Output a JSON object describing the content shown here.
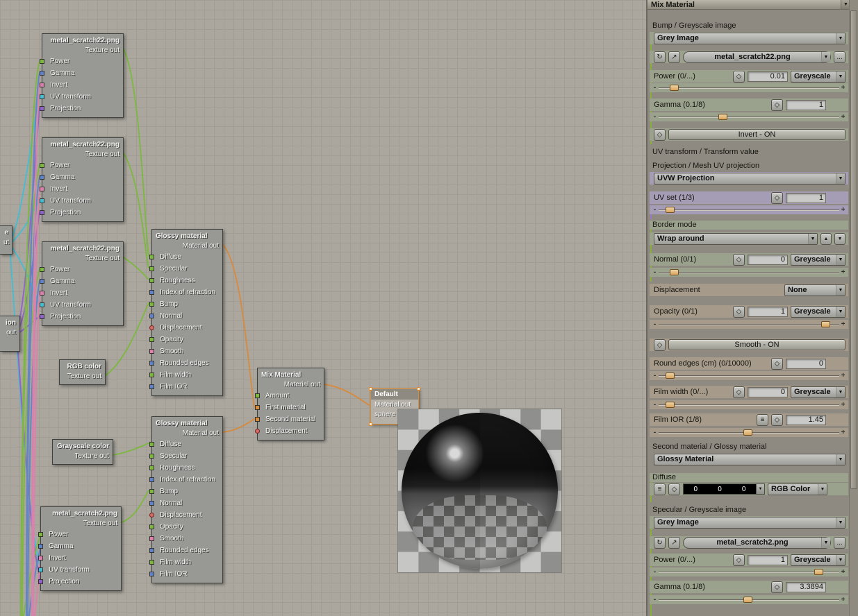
{
  "colors": {
    "canvas_bg": "#aba79f",
    "panel_bg": "#8e8a81",
    "selection_orange": "#e08a2e",
    "pin": {
      "green": "#7cb83e",
      "blue": "#5f82c8",
      "pink": "#df7fae",
      "cyan": "#45bdd3",
      "purple": "#8f62c9",
      "orange": "#d78a3c",
      "red": "#cf7068"
    }
  },
  "canvas": {
    "texture_pins": [
      {
        "label": "Power",
        "color": "green"
      },
      {
        "label": "Gamma",
        "color": "blue"
      },
      {
        "label": "Invert",
        "color": "pink"
      },
      {
        "label": "UV transform",
        "color": "cyan"
      },
      {
        "label": "Projection",
        "color": "purple"
      }
    ],
    "glossy_pins": [
      {
        "label": "Diffuse",
        "color": "green"
      },
      {
        "label": "Specular",
        "color": "green"
      },
      {
        "label": "Roughness",
        "color": "green"
      },
      {
        "label": "Index of refraction",
        "color": "blue"
      },
      {
        "label": "Bump",
        "color": "green"
      },
      {
        "label": "Normal",
        "color": "blue"
      },
      {
        "label": "Displacement",
        "color": "red"
      },
      {
        "label": "Opacity",
        "color": "green"
      },
      {
        "label": "Smooth",
        "color": "pink"
      },
      {
        "label": "Rounded edges",
        "color": "blue"
      },
      {
        "label": "Film width",
        "color": "green"
      },
      {
        "label": "Film IOR",
        "color": "blue"
      }
    ],
    "mix_pins": [
      {
        "label": "Amount",
        "color": "green"
      },
      {
        "label": "First material",
        "color": "orange"
      },
      {
        "label": "Second material",
        "color": "orange"
      },
      {
        "label": "Displacement",
        "color": "red"
      }
    ],
    "nodes": {
      "tex1": {
        "title": "metal_scratch22.png",
        "out_label": "Texture out"
      },
      "tex2": {
        "title": "metal_scratch22.png",
        "out_label": "Texture out"
      },
      "tex3": {
        "title": "metal_scratch22.png",
        "out_label": "Texture out"
      },
      "tex4": {
        "title": "metal_scratch2.png",
        "out_label": "Texture out"
      },
      "glossy1": {
        "title": "Glossy material",
        "out_label": "Material out"
      },
      "glossy2": {
        "title": "Glossy material",
        "out_label": "Material out"
      },
      "rgb": {
        "title": "RGB color",
        "out_label": "Texture out"
      },
      "grayscale": {
        "title": "Grayscale color",
        "out_label": "Texture out"
      },
      "mix": {
        "title": "Mix Material",
        "out_label": "Material out"
      },
      "target": {
        "title": "Default",
        "out_label": "Material out",
        "subtitle": "sphere"
      },
      "partial_top": {
        "title": "e",
        "out_label": "ut"
      },
      "partial_bottom": {
        "title": "ion",
        "out_label": "out"
      }
    }
  },
  "panel": {
    "header": {
      "title": "Mix Material"
    },
    "icons": {
      "refresh": "↻",
      "open": "↗",
      "diamond": "◇",
      "list": "≡",
      "dropdown": "▼",
      "up": "▲",
      "down": "▼",
      "more": "..."
    },
    "slider": {
      "minus": "-",
      "plus": "+"
    },
    "bump": {
      "section_label": "Bump / Greyscale image",
      "type_dropdown": "Grey Image",
      "file_dropdown": "metal_scratch22.png",
      "power_label": "Power (0/...)",
      "power_value": "0.01",
      "power_channel": "Greyscale",
      "gamma_label": "Gamma (0.1/8)",
      "gamma_value": "1",
      "invert_button": "Invert - ON",
      "uv_transform_label": "UV transform / Transform value",
      "projection_label": "Projection / Mesh UV projection",
      "projection_dropdown": "UVW Projection",
      "uv_set_label": "UV set (1/3)",
      "uv_set_value": "1",
      "border_mode_label": "Border mode",
      "border_mode_dropdown": "Wrap around",
      "normal_label": "Normal (0/1)",
      "normal_value": "0",
      "normal_channel": "Greyscale"
    },
    "mix": {
      "displacement_label": "Displacement",
      "displacement_dropdown": "None",
      "opacity_label": "Opacity (0/1)",
      "opacity_value": "1",
      "opacity_channel": "Greyscale",
      "smooth_button": "Smooth - ON",
      "round_edges_label": "Round edges (cm) (0/10000)",
      "round_edges_value": "0",
      "film_width_label": "Film width (0/...)",
      "film_width_value": "0",
      "film_width_channel": "Greyscale",
      "film_ior_label": "Film IOR (1/8)",
      "film_ior_value": "1.45"
    },
    "second": {
      "section_label": "Second material / Glossy material",
      "material_dropdown": "Glossy Material",
      "diffuse_label": "Diffuse",
      "diffuse_r": "0",
      "diffuse_g": "0",
      "diffuse_b": "0",
      "diffuse_channel": "RGB Color",
      "specular_label": "Specular / Greyscale image",
      "type_dropdown": "Grey Image",
      "file_dropdown": "metal_scratch2.png",
      "power_label": "Power (0/...)",
      "power_value": "1",
      "power_channel": "Greyscale",
      "gamma_label": "Gamma (0.1/8)",
      "gamma_value": "3.3894"
    }
  }
}
